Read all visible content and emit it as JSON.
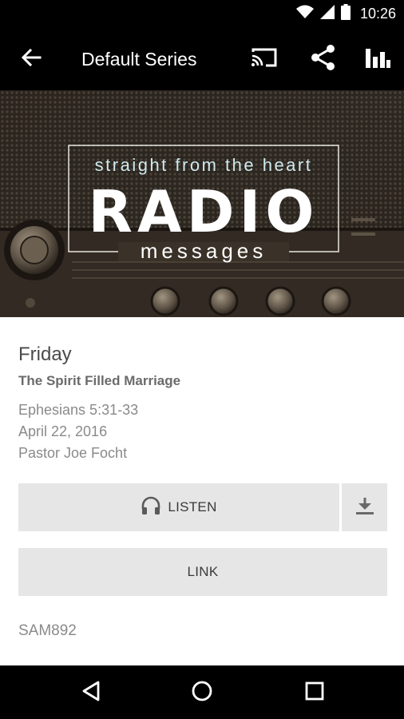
{
  "status_bar": {
    "time": "10:26",
    "icons": [
      "wifi-icon",
      "cell-signal-icon",
      "battery-icon"
    ]
  },
  "app_bar": {
    "title": "Default Series",
    "actions": [
      "back-arrow-icon",
      "cast-icon",
      "share-icon",
      "equalizer-icon"
    ],
    "background": "#000000"
  },
  "banner": {
    "tagline": "straight from the heart",
    "headline": "RADIO",
    "subtitle": "messages"
  },
  "message": {
    "day": "Friday",
    "title": "The Spirit Filled Marriage",
    "scripture": "Ephesians 5:31-33",
    "date": "April 22, 2016",
    "speaker": "Pastor Joe Focht",
    "code": "SAM892"
  },
  "buttons": {
    "listen_label": "LISTEN",
    "link_label": "LINK",
    "background": "#e6e6e6"
  },
  "nav_bar": {
    "items": [
      "back-triangle-icon",
      "home-circle-icon",
      "recents-square-icon"
    ]
  }
}
